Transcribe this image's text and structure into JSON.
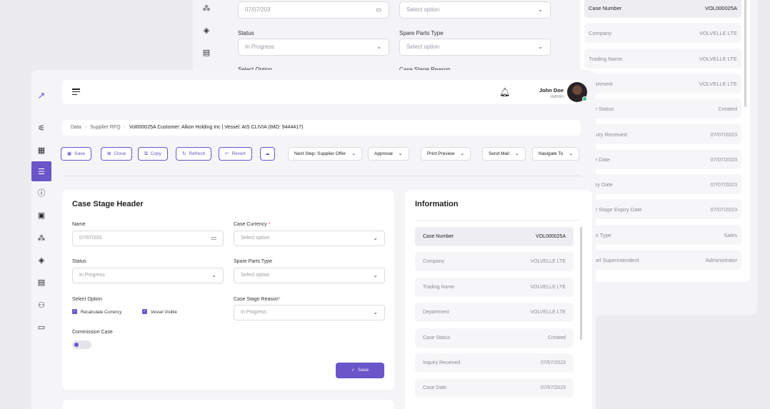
{
  "background": {
    "form": {
      "date_value": "07/07/203",
      "select_placeholder": "Select option",
      "status_label": "Status",
      "status_value": "In Progress",
      "spare_parts_label": "Spare Parts Type",
      "spare_parts_placeholder": "Select option",
      "select_option_label": "Select Option",
      "case_stage_reason_label": "Case Stage Reason"
    },
    "info_rows": [
      {
        "key": "Case Number",
        "value": "VOL000025A"
      },
      {
        "key": "Company",
        "value": "VOLVELLE LTE"
      },
      {
        "key": "Trading Name",
        "value": "VOLVELLE LTE"
      },
      {
        "key": "epartment",
        "value": "VOLVELLE LTE"
      },
      {
        "key": "ase Status",
        "value": "Created"
      },
      {
        "key": "nquiry Received",
        "value": "07/07/2023"
      },
      {
        "key": "ase Date",
        "value": "07/07/2023"
      },
      {
        "key": "xpiry Date",
        "value": "07/07/2023"
      },
      {
        "key": "ase Stage Expiry Date",
        "value": "07/07/2023"
      },
      {
        "key": "ales Type",
        "value": "Sales"
      },
      {
        "key": "essel Superintendent",
        "value": "Administrator"
      }
    ]
  },
  "header": {
    "user_name": "John Doe",
    "user_role": "Admin"
  },
  "breadcrumb": {
    "items": [
      "Data",
      "Supplier RFQ"
    ],
    "current": "Vol000025A Customer: Alkon Holding Inc | Vessel: AIS CLIVIA (IMO: 9444417)"
  },
  "toolbar": {
    "save": "Save",
    "close": "Close",
    "copy": "Copy",
    "refresh": "Refresh",
    "revert": "Revert",
    "next_step": "Next Step: Supplier Offer",
    "approval": "Approval",
    "print_preview": "Print Preview",
    "send_mail": "Send Mail",
    "navigate_to": "Navigate To"
  },
  "form": {
    "title": "Case Stage Header",
    "name_label": "Name",
    "name_value": "07/07/203",
    "currency_label": "Case Currency",
    "currency_placeholder": "Select option",
    "status_label": "Status",
    "status_value": "In Progress",
    "spare_parts_label": "Spare Parts Type",
    "spare_parts_placeholder": "Select option",
    "select_option_label": "Select Option",
    "recalculate_label": "Recalculate Currency",
    "vessel_visible_label": "Vessel Visible",
    "reason_label": "Case Stage Reason",
    "reason_value": "In Progress",
    "commission_label": "Commission Case",
    "save_label": "Save",
    "required_mark": "*"
  },
  "info": {
    "title": "Information",
    "rows": [
      {
        "key": "Case Number",
        "value": "VOL000025A"
      },
      {
        "key": "Company",
        "value": "VOLVELLE LTE"
      },
      {
        "key": "Trading Name",
        "value": "VOLVELLE LTE"
      },
      {
        "key": "Department",
        "value": "VOLVELLE LTE"
      },
      {
        "key": "Case Status",
        "value": "Created"
      },
      {
        "key": "Inquiry Received",
        "value": "07/07/2023"
      },
      {
        "key": "Case Date",
        "value": "07/07/2023"
      }
    ]
  },
  "colors": {
    "accent": "#6a55c9",
    "online": "#2ec27e",
    "required": "#e04b4b"
  }
}
